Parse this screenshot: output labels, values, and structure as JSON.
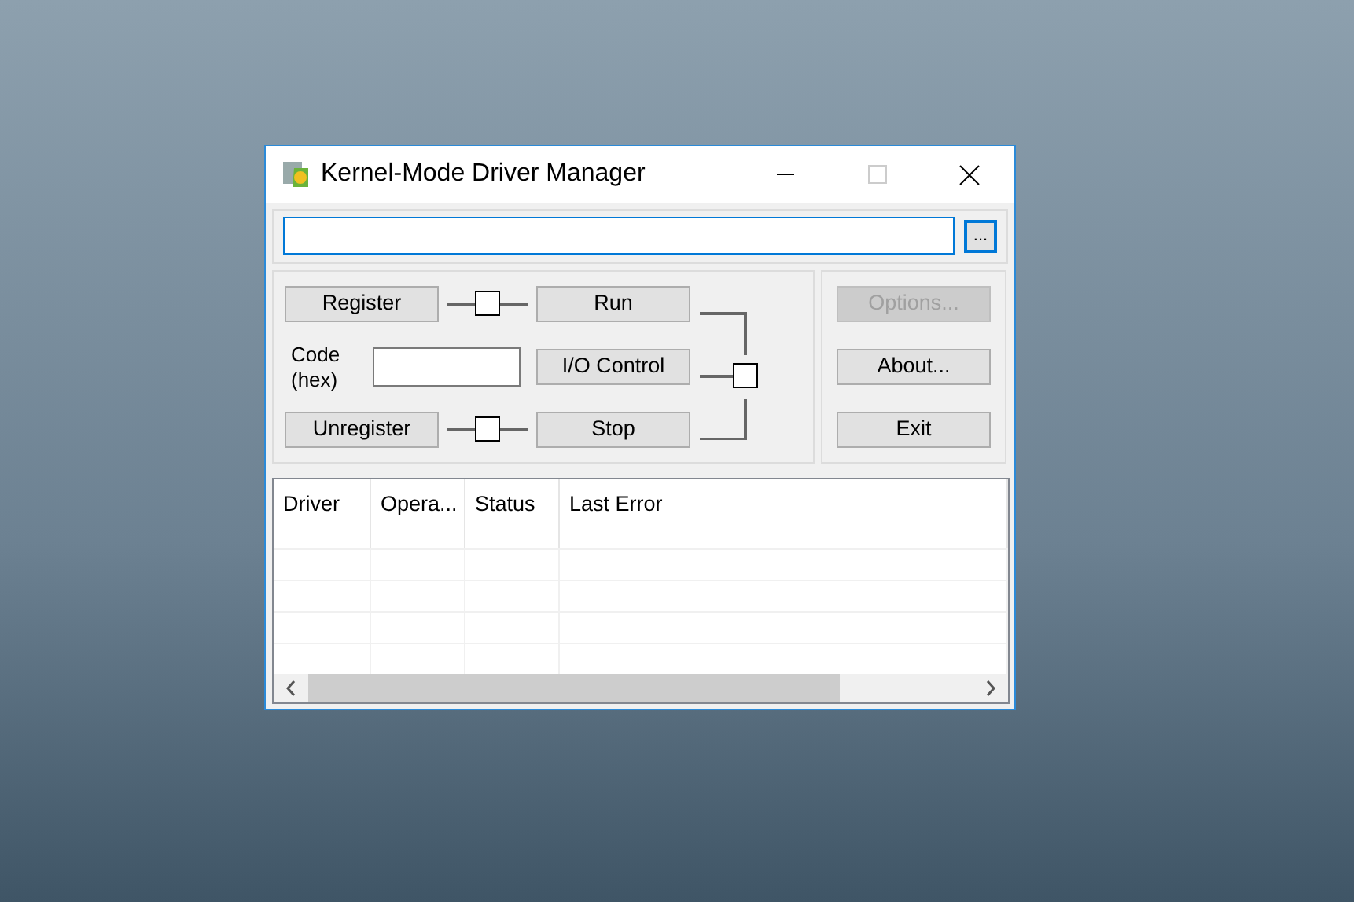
{
  "window": {
    "title": "Kernel-Mode Driver Manager"
  },
  "path_field": {
    "focused": true
  },
  "browse_button": {
    "label": "..."
  },
  "actions": {
    "register": "Register",
    "unregister": "Unregister",
    "run": "Run",
    "io_control": "I/O Control",
    "stop": "Stop",
    "code_label": "Code (hex)"
  },
  "side_buttons": [
    {
      "label": "Options...",
      "disabled": true
    },
    {
      "label": "About...",
      "disabled": false
    },
    {
      "label": "Exit",
      "disabled": false
    }
  ],
  "table": {
    "columns": [
      "Driver",
      "Opera...",
      "Status",
      "Last Error"
    ]
  }
}
